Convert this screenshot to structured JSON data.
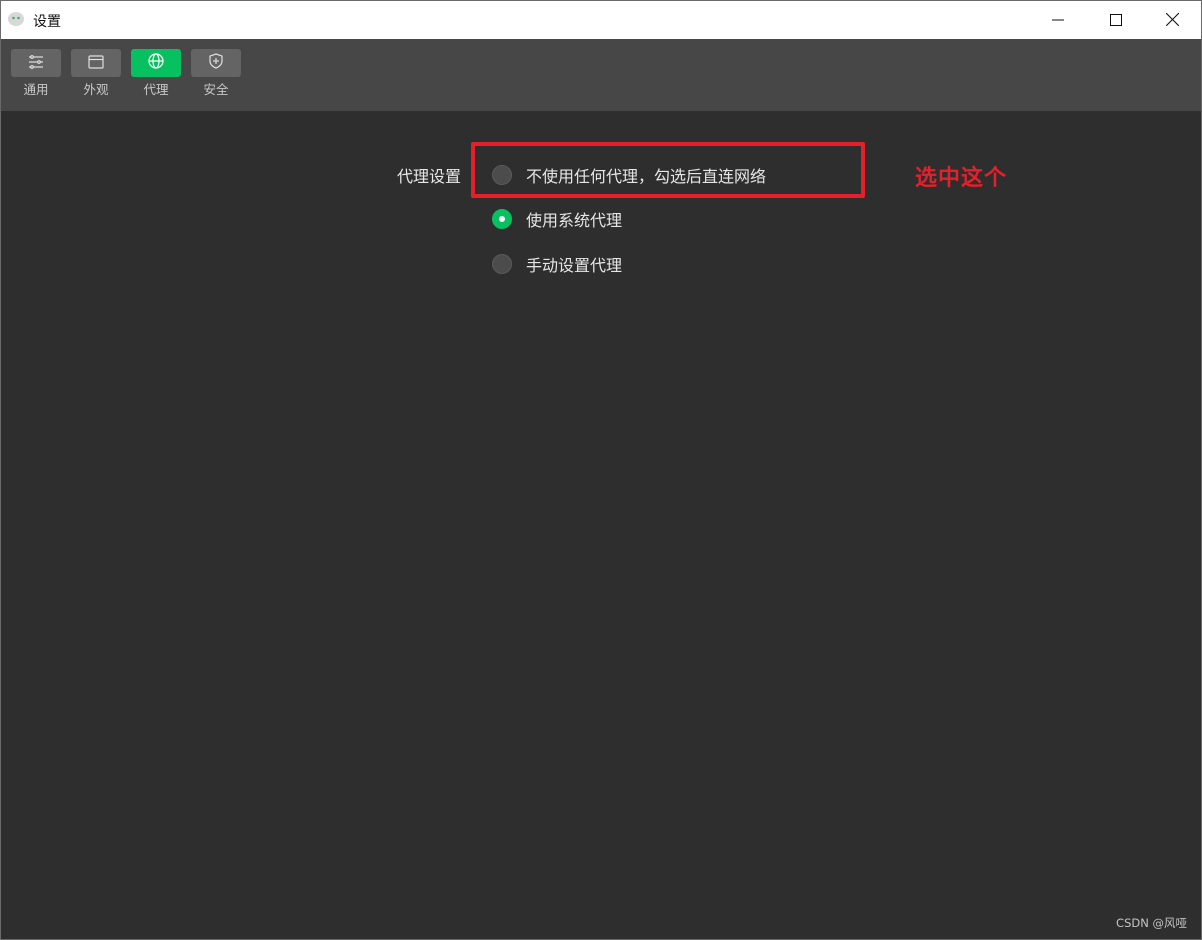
{
  "window": {
    "title": "设置",
    "minimize_icon": "minimize-icon",
    "maximize_icon": "maximize-icon",
    "close_icon": "close-icon"
  },
  "toolbar": {
    "items": [
      {
        "label": "通用",
        "icon": "sliders-icon",
        "active": false
      },
      {
        "label": "外观",
        "icon": "window-icon",
        "active": false
      },
      {
        "label": "代理",
        "icon": "globe-icon",
        "active": true
      },
      {
        "label": "安全",
        "icon": "shield-icon",
        "active": false
      }
    ],
    "active_color": "#07c160"
  },
  "proxy": {
    "section_label": "代理设置",
    "options": [
      {
        "label": "不使用任何代理，勾选后直连网络",
        "checked": false
      },
      {
        "label": "使用系统代理",
        "checked": true
      },
      {
        "label": "手动设置代理",
        "checked": false
      }
    ]
  },
  "annotation": {
    "text": "选中这个",
    "color": "#e5202a"
  },
  "watermark": "CSDN @风哑"
}
